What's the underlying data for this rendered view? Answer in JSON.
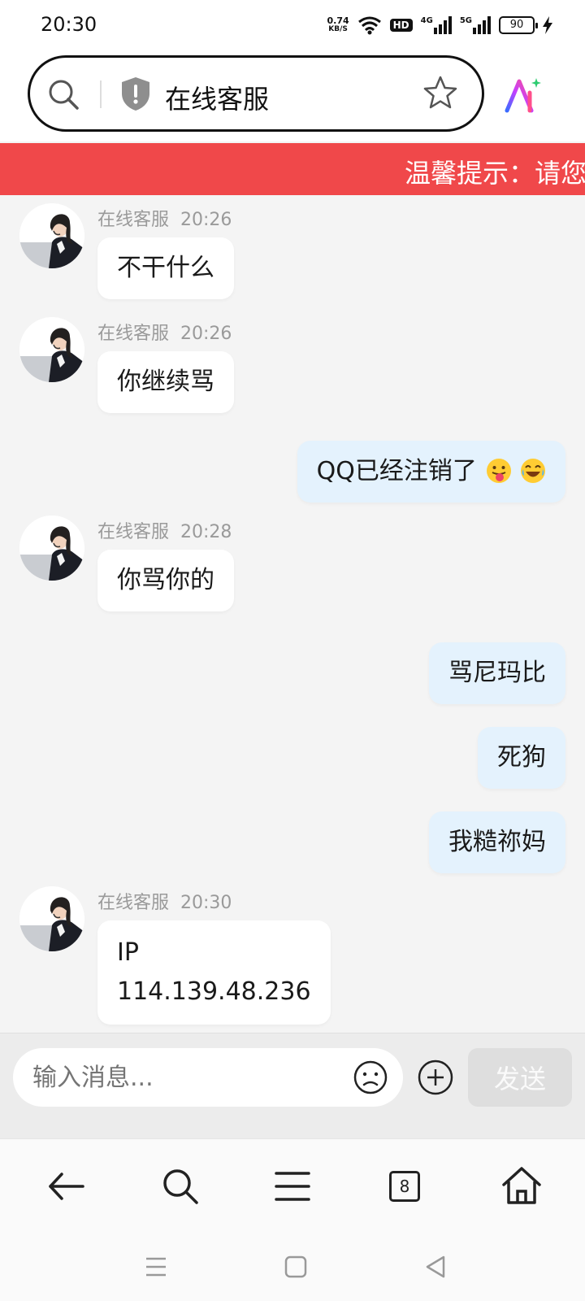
{
  "status_bar": {
    "time": "20:30",
    "net_speed_value": "0.74",
    "net_speed_unit": "KB/S",
    "hd_label": "HD",
    "sim1_label": "4G",
    "sim2_label": "5G",
    "battery": "90"
  },
  "browser": {
    "url_title": "在线客服"
  },
  "notice": {
    "text": "温馨提示：请您"
  },
  "chat": {
    "agent_name": "在线客服",
    "messages": [
      {
        "side": "left",
        "time": "20:26",
        "text": "不干什么"
      },
      {
        "side": "left",
        "time": "20:26",
        "text": "你继续骂"
      },
      {
        "side": "right",
        "text": "QQ已经注销了"
      },
      {
        "side": "left",
        "time": "20:28",
        "text": "你骂你的"
      },
      {
        "side": "right",
        "text": "骂尼玛比"
      },
      {
        "side": "right",
        "text": "死狗"
      },
      {
        "side": "right",
        "text": "我糙祢妈"
      },
      {
        "side": "left",
        "time": "20:30",
        "text_line1": "IP",
        "text_line2": "114.139.48.236"
      }
    ]
  },
  "input": {
    "placeholder": "输入消息...",
    "send_label": "发送"
  },
  "bottom_nav": {
    "tab_count": "8"
  },
  "icons": [
    "search-icon",
    "shield-icon",
    "star-icon",
    "ai-assistant-icon",
    "emoji-icon",
    "plus-icon",
    "back-arrow-icon",
    "menu-icon",
    "tabs-icon",
    "home-icon"
  ],
  "colors": {
    "notice_bg": "#f0484a",
    "right_bubble": "#e4f2fd",
    "chat_bg": "#f4f4f4"
  }
}
